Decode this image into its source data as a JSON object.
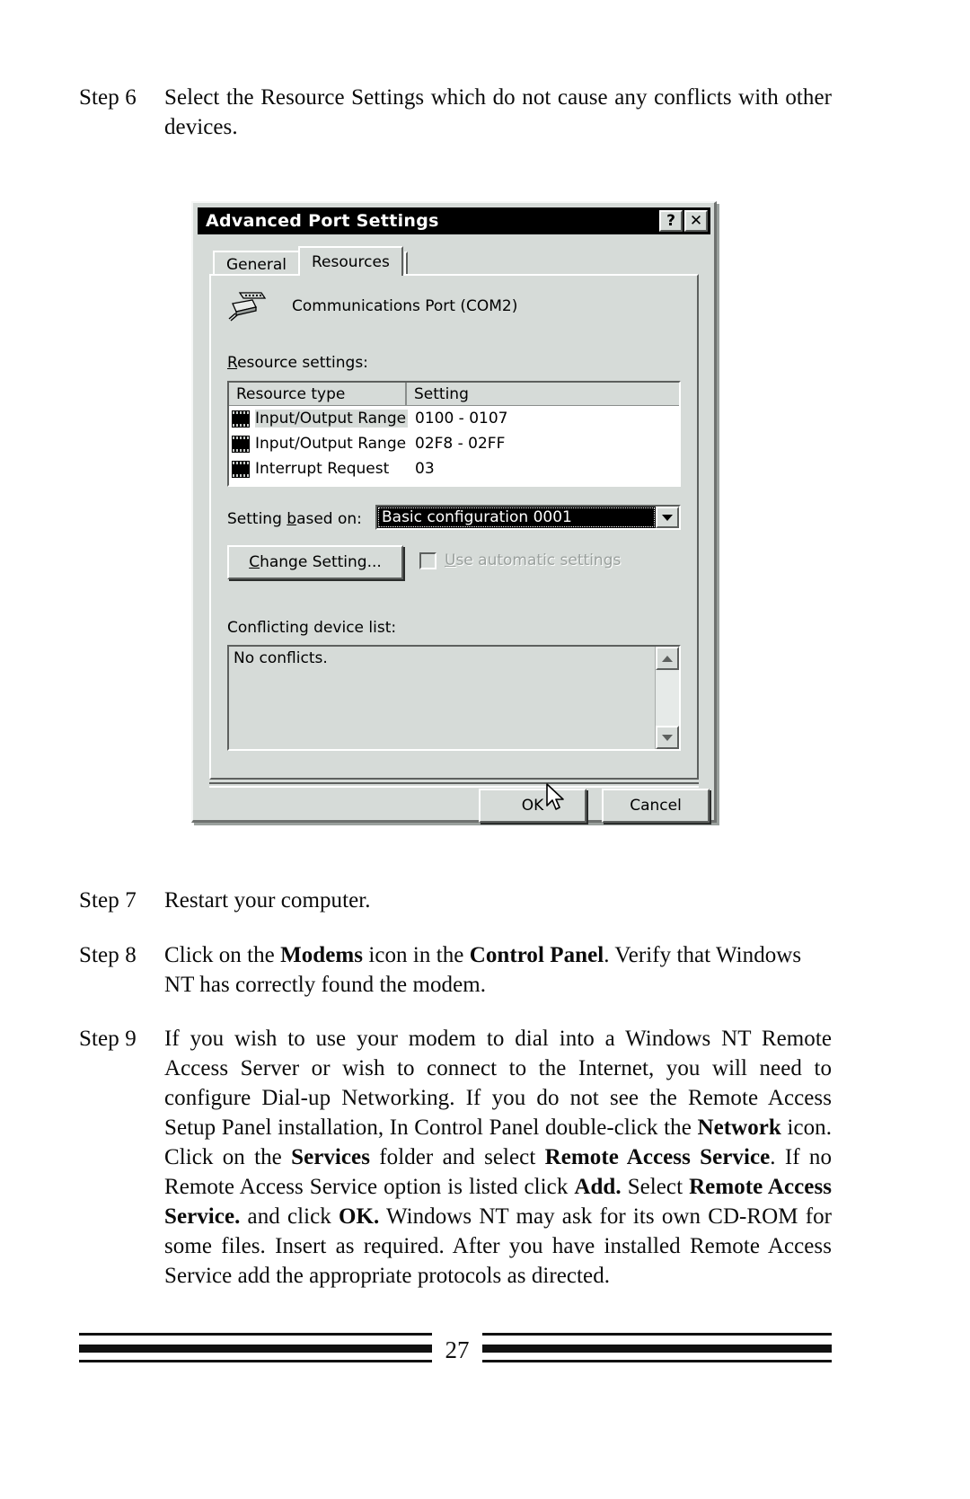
{
  "document": {
    "page_number": "27",
    "steps": [
      {
        "label": "Step 6",
        "text": "Select the Resource Settings which do not cause any conflicts with other devices."
      },
      {
        "label": "Step 7",
        "text": "Restart your computer."
      },
      {
        "label": "Step 8",
        "text": "Click on the Modems icon in the Control Panel. Verify that Windows NT has correctly found the modem."
      },
      {
        "label": "Step 9",
        "text": "If you wish to use your modem to dial into a Windows NT Remote Access Server or wish to connect to the Internet, you will need to configure Dial-up Networking. If you do not see the Remote Access Setup Panel installation, In Control Panel double-click the Network icon. Click on the Services folder and select Remote Access Service. If no Remote Access Service option is listed click Add. Select Remote Access Service. and click OK. Windows NT may ask for its own CD-ROM for some files. Insert as required. After you have installed Remote Access Service add the appropriate protocols as directed."
      }
    ]
  },
  "dialog": {
    "title": "Advanced Port Settings",
    "titlebar_buttons": [
      {
        "name": "help-button",
        "glyph": "?"
      },
      {
        "name": "close-button",
        "glyph": "✕"
      }
    ],
    "tabs": [
      {
        "label": "General",
        "active": false
      },
      {
        "label": "Resources",
        "active": true
      }
    ],
    "device": {
      "icon": "serial-port-icon",
      "name": "Communications Port (COM2)"
    },
    "resource_settings": {
      "label": "Resource settings:",
      "columns": [
        "Resource type",
        "Setting"
      ],
      "rows": [
        {
          "type": "Input/Output Range",
          "setting": "0100 - 0107",
          "selected": true
        },
        {
          "type": "Input/Output Range",
          "setting": "02F8 - 02FF",
          "selected": false
        },
        {
          "type": "Interrupt Request",
          "setting": "03",
          "selected": false
        }
      ]
    },
    "setting_based_on": {
      "label": "Setting based on:",
      "value": "Basic configuration 0001"
    },
    "change_setting_button": "Change Setting...",
    "use_automatic": {
      "label": "Use automatic settings",
      "checked": false,
      "disabled": true
    },
    "conflicting_device_list": {
      "label": "Conflicting device list:",
      "text": "No conflicts."
    },
    "ok_button": "OK",
    "cancel_button": "Cancel",
    "colors": {
      "face": "#d6dbd8",
      "titlebar": "#000000",
      "titlebar_text": "#ffffff",
      "highlight": "#ffffff",
      "shadow": "#5d605e",
      "disabled_text": "#9aa09d"
    }
  }
}
